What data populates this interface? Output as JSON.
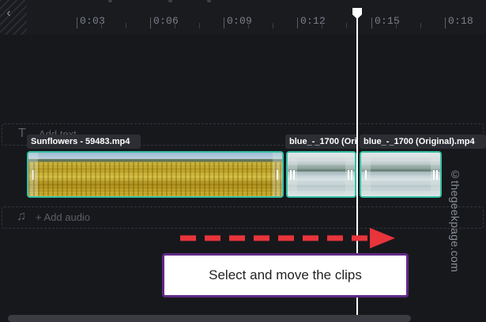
{
  "ruler": {
    "back_icon": "chevron-left-icon",
    "ticks": [
      "0:03",
      "0:06",
      "0:09",
      "0:12",
      "0:15",
      "0:18"
    ]
  },
  "text_lane": {
    "icon": "text-icon",
    "label": "Add text"
  },
  "clips": [
    {
      "label": "Sunflowers - 59483.mp4",
      "thumbnail": "sunflower-field"
    },
    {
      "label": "blue_-_1700 (Ori",
      "thumbnail": "mountain-lake"
    },
    {
      "label": "blue_-_1700 (Original).mp4",
      "thumbnail": "mountain-lake"
    }
  ],
  "audio_lane": {
    "icon": "music-note-icon",
    "label": "+ Add audio"
  },
  "annotation": {
    "callout_text": "Select and move the clips",
    "arrow_color": "#e8343b",
    "border_color": "#5f2a86"
  },
  "watermark": "©thegeekpage.com",
  "colors": {
    "background": "#17181c",
    "clip_border": "#36bfa5",
    "playhead": "#ffffff"
  }
}
